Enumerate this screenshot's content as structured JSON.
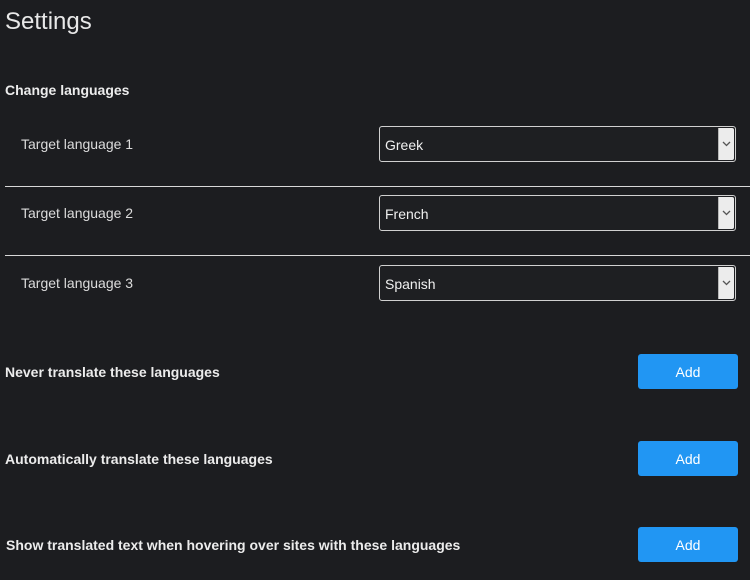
{
  "page": {
    "title": "Settings"
  },
  "change_languages": {
    "heading": "Change languages",
    "rows": [
      {
        "label": "Target language 1",
        "value": "Greek"
      },
      {
        "label": "Target language 2",
        "value": "French"
      },
      {
        "label": "Target language 3",
        "value": "Spanish"
      }
    ]
  },
  "options": [
    {
      "label": "Never translate these languages",
      "button": "Add"
    },
    {
      "label": "Automatically translate these languages",
      "button": "Add"
    },
    {
      "label": "Show translated text when hovering over sites with these languages",
      "button": "Add"
    }
  ],
  "colors": {
    "background": "#1c1d20",
    "accent": "#2196f3",
    "text": "#e8e8e8"
  },
  "icons": {
    "select_arrow": "chevron-down-icon"
  }
}
